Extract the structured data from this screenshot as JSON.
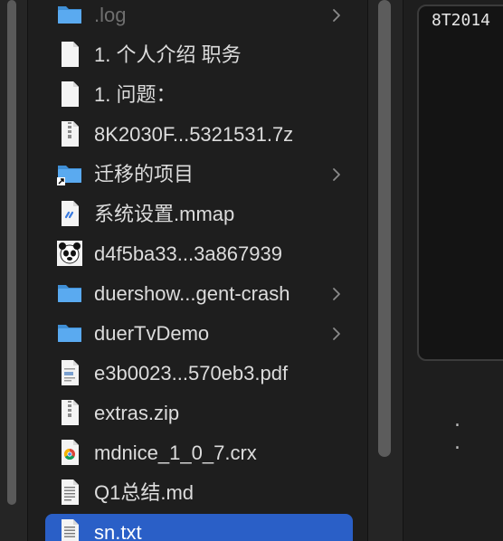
{
  "files": [
    {
      "name": ".log",
      "icon": "folder-icon",
      "has_chevron": true,
      "dim": true
    },
    {
      "name": "1. 个人介绍 职务",
      "icon": "document-icon",
      "has_chevron": false
    },
    {
      "name": "1. 问题：",
      "icon": "document-icon",
      "has_chevron": false
    },
    {
      "name": "8K2030F...5321531.7z",
      "icon": "archive-icon",
      "has_chevron": false
    },
    {
      "name": "迁移的项目",
      "icon": "folder-alias-icon",
      "has_chevron": true
    },
    {
      "name": "系统设置.mmap",
      "icon": "mindmap-file-icon",
      "has_chevron": false
    },
    {
      "name": "d4f5ba33...3a867939",
      "icon": "panda-image-icon",
      "has_chevron": false
    },
    {
      "name": "duershow...gent-crash",
      "icon": "folder-icon",
      "has_chevron": true
    },
    {
      "name": "duerTvDemo",
      "icon": "folder-icon",
      "has_chevron": true
    },
    {
      "name": "e3b0023...570eb3.pdf",
      "icon": "pdf-file-icon",
      "has_chevron": false
    },
    {
      "name": "extras.zip",
      "icon": "archive-icon",
      "has_chevron": false
    },
    {
      "name": "mdnice_1_0_7.crx",
      "icon": "chrome-extension-icon",
      "has_chevron": false
    },
    {
      "name": "Q1总结.md",
      "icon": "markdown-file-icon",
      "has_chevron": false
    },
    {
      "name": "sn.txt",
      "icon": "text-file-icon",
      "has_chevron": false,
      "selected": true
    }
  ],
  "preview": {
    "text": "8T2014",
    "dots": ". ."
  },
  "colors": {
    "selection": "#2a5fc7",
    "folder": "#4a9de0",
    "text": "#dcdcdc"
  }
}
